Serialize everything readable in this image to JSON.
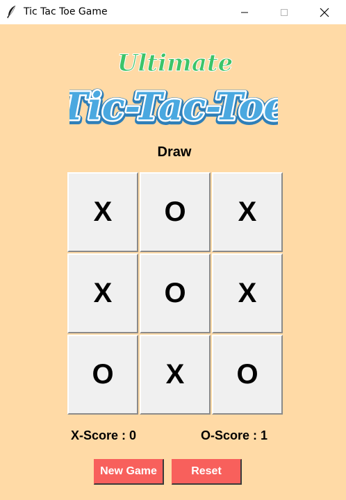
{
  "window": {
    "title": "Tic Tac Toe Game",
    "icon": "feather-icon"
  },
  "logo": {
    "top_text": "Ultimate",
    "main_text": "Tic-Tac-Toe",
    "top_color": "#3cc46a",
    "main_color": "#4aa8e0"
  },
  "status": "Draw",
  "board": [
    [
      "X",
      "O",
      "X"
    ],
    [
      "X",
      "O",
      "X"
    ],
    [
      "O",
      "X",
      "O"
    ]
  ],
  "scores": {
    "x_label": "X-Score : 0",
    "o_label": "O-Score : 1"
  },
  "buttons": {
    "new_game": "New Game",
    "reset": "Reset"
  },
  "colors": {
    "background": "#ffdaa6",
    "button": "#f8605c",
    "cell": "#f0f0f0"
  }
}
